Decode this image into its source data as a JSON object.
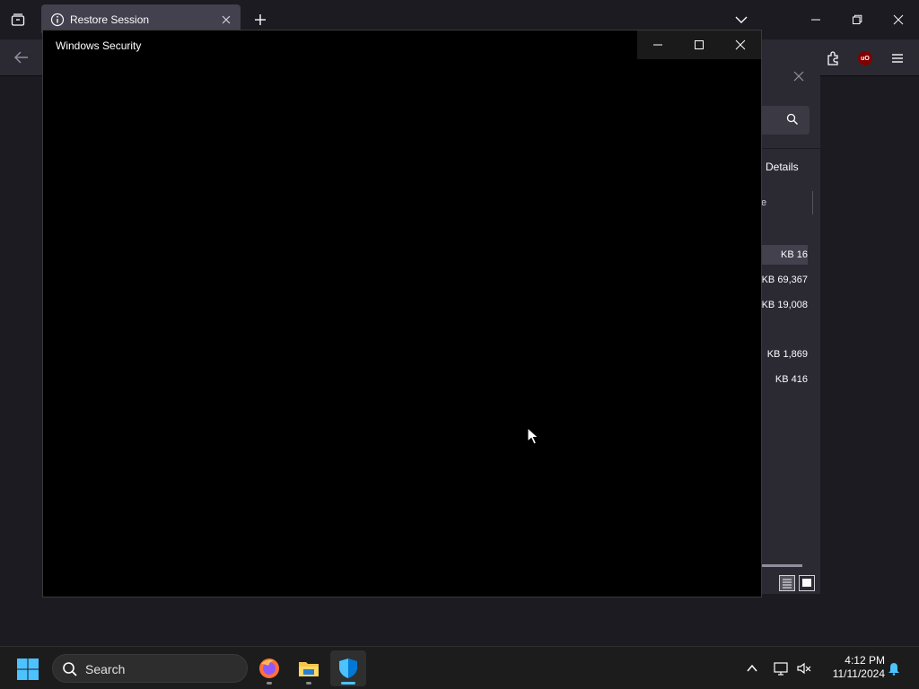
{
  "firefox": {
    "tab_title": "Restore Session"
  },
  "background_panel": {
    "details_label": "Details",
    "column_header_fragment": "e",
    "rows": [
      {
        "size": "16 KB",
        "selected": true
      },
      {
        "size": "69,367 KB",
        "selected": false
      },
      {
        "size": "19,008 KB",
        "selected": false
      },
      {
        "size": "1,869 KB",
        "selected": false
      },
      {
        "size": "416 KB",
        "selected": false
      }
    ]
  },
  "security_window": {
    "title": "Windows Security"
  },
  "taskbar": {
    "search_label": "Search",
    "time": "4:12 PM",
    "date": "11/11/2024"
  },
  "colors": {
    "accent": "#4cc2ff",
    "ublock": "#800000",
    "shield": "#0078d4"
  }
}
